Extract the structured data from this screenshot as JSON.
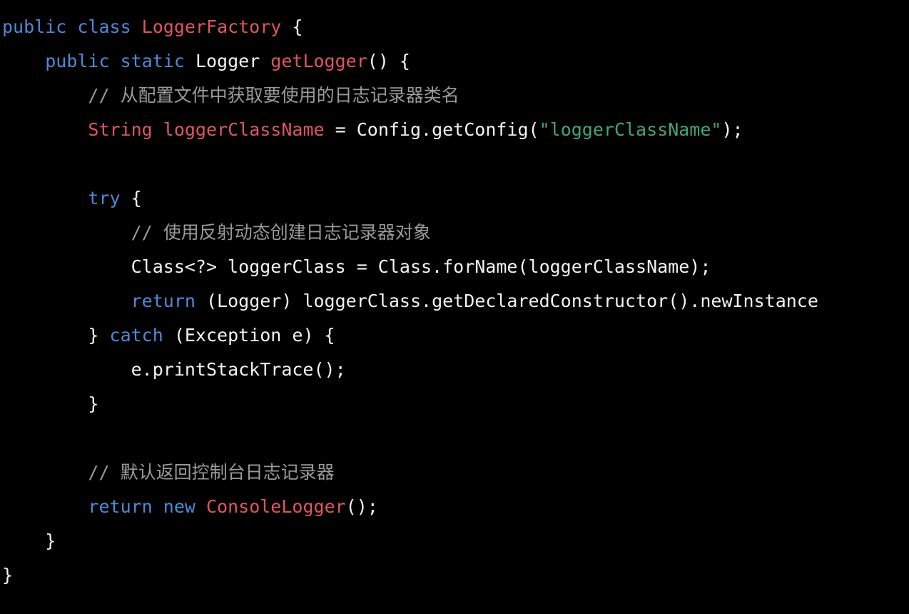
{
  "colors": {
    "background": "#000000",
    "keyword": "#4d8ad6",
    "identifier": "#e05561",
    "string": "#3fa67a",
    "comment": "#9a9a9a",
    "plain": "#f2f2f2"
  },
  "code": {
    "lines": [
      {
        "tokens": [
          {
            "text": "public class ",
            "kind": "keyword"
          },
          {
            "text": "LoggerFactory",
            "kind": "identifier"
          },
          {
            "text": " {",
            "kind": "plain"
          }
        ]
      },
      {
        "tokens": [
          {
            "text": "    ",
            "kind": "plain"
          },
          {
            "text": "public static ",
            "kind": "keyword"
          },
          {
            "text": "Logger ",
            "kind": "plain"
          },
          {
            "text": "getLogger",
            "kind": "identifier"
          },
          {
            "text": "() {",
            "kind": "plain"
          }
        ]
      },
      {
        "tokens": [
          {
            "text": "        // 从配置文件中获取要使用的日志记录器类名",
            "kind": "comment"
          }
        ]
      },
      {
        "tokens": [
          {
            "text": "        ",
            "kind": "plain"
          },
          {
            "text": "String loggerClassName",
            "kind": "identifier"
          },
          {
            "text": " = Config.getConfig(",
            "kind": "plain"
          },
          {
            "text": "\"loggerClassName\"",
            "kind": "string"
          },
          {
            "text": ");",
            "kind": "plain"
          }
        ]
      },
      {
        "tokens": []
      },
      {
        "tokens": [
          {
            "text": "        ",
            "kind": "plain"
          },
          {
            "text": "try",
            "kind": "keyword"
          },
          {
            "text": " {",
            "kind": "plain"
          }
        ]
      },
      {
        "tokens": [
          {
            "text": "            // 使用反射动态创建日志记录器对象",
            "kind": "comment"
          }
        ]
      },
      {
        "tokens": [
          {
            "text": "            Class<?> loggerClass = Class.forName(loggerClassName);",
            "kind": "plain"
          }
        ]
      },
      {
        "tokens": [
          {
            "text": "            ",
            "kind": "plain"
          },
          {
            "text": "return",
            "kind": "keyword"
          },
          {
            "text": " (Logger) loggerClass.getDeclaredConstructor().newInstance",
            "kind": "plain"
          }
        ]
      },
      {
        "tokens": [
          {
            "text": "        } ",
            "kind": "plain"
          },
          {
            "text": "catch",
            "kind": "keyword"
          },
          {
            "text": " (Exception e) {",
            "kind": "plain"
          }
        ]
      },
      {
        "tokens": [
          {
            "text": "            e.printStackTrace();",
            "kind": "plain"
          }
        ]
      },
      {
        "tokens": [
          {
            "text": "        }",
            "kind": "plain"
          }
        ]
      },
      {
        "tokens": []
      },
      {
        "tokens": [
          {
            "text": "        // 默认返回控制台日志记录器",
            "kind": "comment"
          }
        ]
      },
      {
        "tokens": [
          {
            "text": "        ",
            "kind": "plain"
          },
          {
            "text": "return new ",
            "kind": "keyword"
          },
          {
            "text": "ConsoleLogger",
            "kind": "identifier"
          },
          {
            "text": "();",
            "kind": "plain"
          }
        ]
      },
      {
        "tokens": [
          {
            "text": "    }",
            "kind": "plain"
          }
        ]
      },
      {
        "tokens": [
          {
            "text": "}",
            "kind": "plain"
          }
        ]
      }
    ]
  }
}
